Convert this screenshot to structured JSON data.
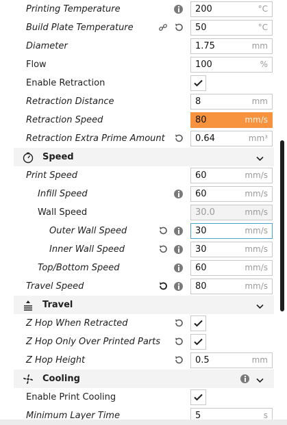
{
  "settings": {
    "printing_temperature": {
      "label": "Printing Temperature",
      "value": "200",
      "unit": "°C"
    },
    "build_plate_temperature": {
      "label": "Build Plate Temperature",
      "value": "50",
      "unit": "°C"
    },
    "diameter": {
      "label": "Diameter",
      "value": "1.75",
      "unit": "mm"
    },
    "flow": {
      "label": "Flow",
      "value": "100",
      "unit": "%"
    },
    "enable_retraction": {
      "label": "Enable Retraction",
      "checked": true
    },
    "retraction_distance": {
      "label": "Retraction Distance",
      "value": "8",
      "unit": "mm"
    },
    "retraction_speed": {
      "label": "Retraction Speed",
      "value": "80",
      "unit": "mm/s"
    },
    "retraction_extra_prime_amount": {
      "label": "Retraction Extra Prime Amount",
      "value": "0.64",
      "unit": "mm³"
    }
  },
  "speed": {
    "category_label": "Speed",
    "print_speed": {
      "label": "Print Speed",
      "value": "60",
      "unit": "mm/s"
    },
    "infill_speed": {
      "label": "Infill Speed",
      "value": "60",
      "unit": "mm/s"
    },
    "wall_speed": {
      "label": "Wall Speed",
      "value": "30.0",
      "unit": "mm/s"
    },
    "outer_wall_speed": {
      "label": "Outer Wall Speed",
      "value": "30",
      "unit": "mm/s"
    },
    "inner_wall_speed": {
      "label": "Inner Wall Speed",
      "value": "30",
      "unit": "mm/s"
    },
    "top_bottom_speed": {
      "label": "Top/Bottom Speed",
      "value": "60",
      "unit": "mm/s"
    },
    "travel_speed": {
      "label": "Travel Speed",
      "value": "80",
      "unit": "mm/s"
    }
  },
  "travel": {
    "category_label": "Travel",
    "z_hop_when_retracted": {
      "label": "Z Hop When Retracted",
      "checked": true
    },
    "z_hop_only_over_printed_parts": {
      "label": "Z Hop Only Over Printed Parts",
      "checked": true
    },
    "z_hop_height": {
      "label": "Z Hop Height",
      "value": "0.5",
      "unit": "mm"
    }
  },
  "cooling": {
    "category_label": "Cooling",
    "enable_print_cooling": {
      "label": "Enable Print Cooling",
      "checked": true
    },
    "minimum_layer_time": {
      "label": "Minimum Layer Time",
      "value": "5",
      "unit": "s"
    }
  },
  "colors": {
    "error_field": "#f7933e",
    "focus_border": "#4aa3c8",
    "category_bg": "#f3f3f3"
  },
  "icons": {
    "info": "info-icon",
    "reset": "reset-icon",
    "link": "link-icon",
    "speed": "speedometer-icon",
    "travel": "travel-icon",
    "cooling": "fan-icon",
    "chevron": "chevron-down-icon"
  }
}
